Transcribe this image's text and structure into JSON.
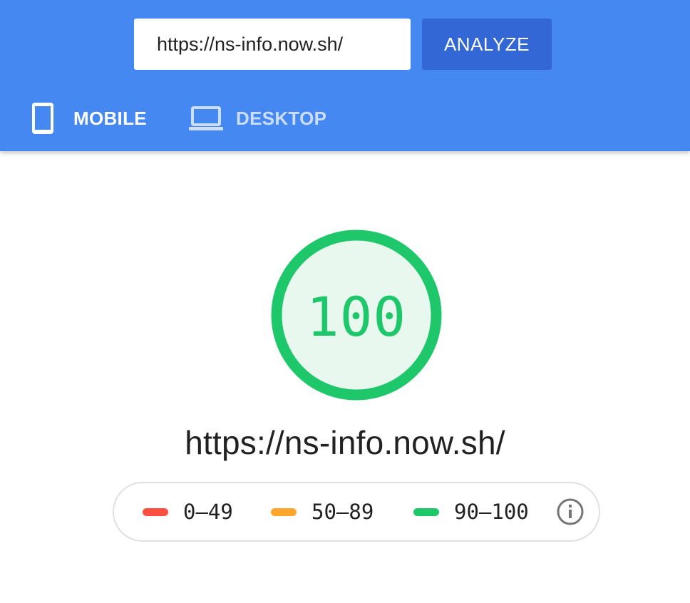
{
  "header": {
    "url_value": "https://ns-info.now.sh/",
    "analyze_label": "ANALYZE",
    "tabs": [
      {
        "label": "MOBILE",
        "icon": "phone-icon",
        "selected": true
      },
      {
        "label": "DESKTOP",
        "icon": "laptop-icon",
        "selected": false
      }
    ]
  },
  "colors": {
    "header_bg": "#4688F1",
    "analyze_bg": "#3367D6",
    "pass": "#1FC76B",
    "average": "#FFA62B",
    "fail": "#FF4E42"
  },
  "result": {
    "score": "100",
    "score_fraction": 1.0,
    "url": "https://ns-info.now.sh/"
  },
  "legend": {
    "items": [
      {
        "label": "0–49",
        "color": "#FF4E42"
      },
      {
        "label": "50–89",
        "color": "#FFA62B"
      },
      {
        "label": "90–100",
        "color": "#1FC76B"
      }
    ],
    "info_icon": "info-icon"
  }
}
